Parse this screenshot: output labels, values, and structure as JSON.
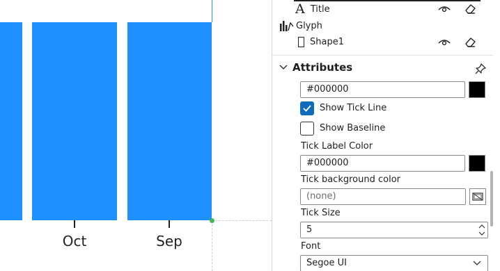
{
  "chart_data": {
    "type": "bar",
    "categories": [
      "Oct",
      "Sep"
    ],
    "tick_labels": [
      "Oct",
      "Sep"
    ]
  },
  "colors": {
    "bar": "#1e90ff",
    "accent": "#0f6cbd",
    "swatch": "#000000",
    "handle": "#3cba54"
  },
  "layers": {
    "title_label": "Title",
    "glyph_label": "Glyph",
    "shape_label": "Shape1"
  },
  "attributes": {
    "section_title": "Attributes",
    "color_value": "#000000",
    "show_tick_line_label": "Show Tick Line",
    "show_tick_line_checked": true,
    "show_baseline_label": "Show Baseline",
    "show_baseline_checked": false,
    "tick_label_color_label": "Tick Label Color",
    "tick_label_color_value": "#000000",
    "tick_bg_color_label": "Tick background color",
    "tick_bg_color_placeholder": "(none)",
    "tick_size_label": "Tick Size",
    "tick_size_value": "5",
    "font_label": "Font",
    "font_value": "Segoe UI"
  },
  "icons": {
    "title_icon": "text-a-icon",
    "glyph_icon": "glyph-chart-icon",
    "shape_icon": "rectangle-icon",
    "visibility_icon": "eye-icon",
    "eraser_icon": "eraser-icon",
    "collapse_icon": "chevron-down-icon",
    "pin_icon": "pin-icon",
    "color_picker_icon": "color-picker-icon"
  }
}
